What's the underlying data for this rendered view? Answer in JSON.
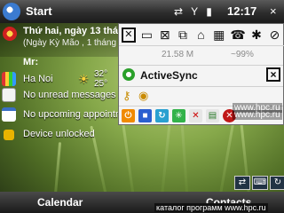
{
  "titlebar": {
    "title": "Start",
    "time": "12:17",
    "close_label": "×"
  },
  "today": {
    "date_line": "Thứ hai, ngày 13 thá",
    "lunar_line": "(Ngày Kỳ Mão , 1 tháng 7",
    "owner": "Mr:",
    "weather": {
      "city": "Ha Noi",
      "temp_high": "32°",
      "temp_low": "25°"
    },
    "messages": "No unread messages",
    "appointments": "No upcoming appointm",
    "lock_status": "Device unlocked"
  },
  "panel": {
    "memory": "21.58 M",
    "memory_pct": "~99%",
    "activesync_label": "ActiveSync",
    "close_label": "×"
  },
  "watermarks": {
    "site1": "www.hpc.ru",
    "site2": "www.hpc.ru",
    "catalog": "каталог программ www.hpc.ru"
  },
  "softkeys": {
    "left": "Calendar",
    "right": "Contacts"
  }
}
